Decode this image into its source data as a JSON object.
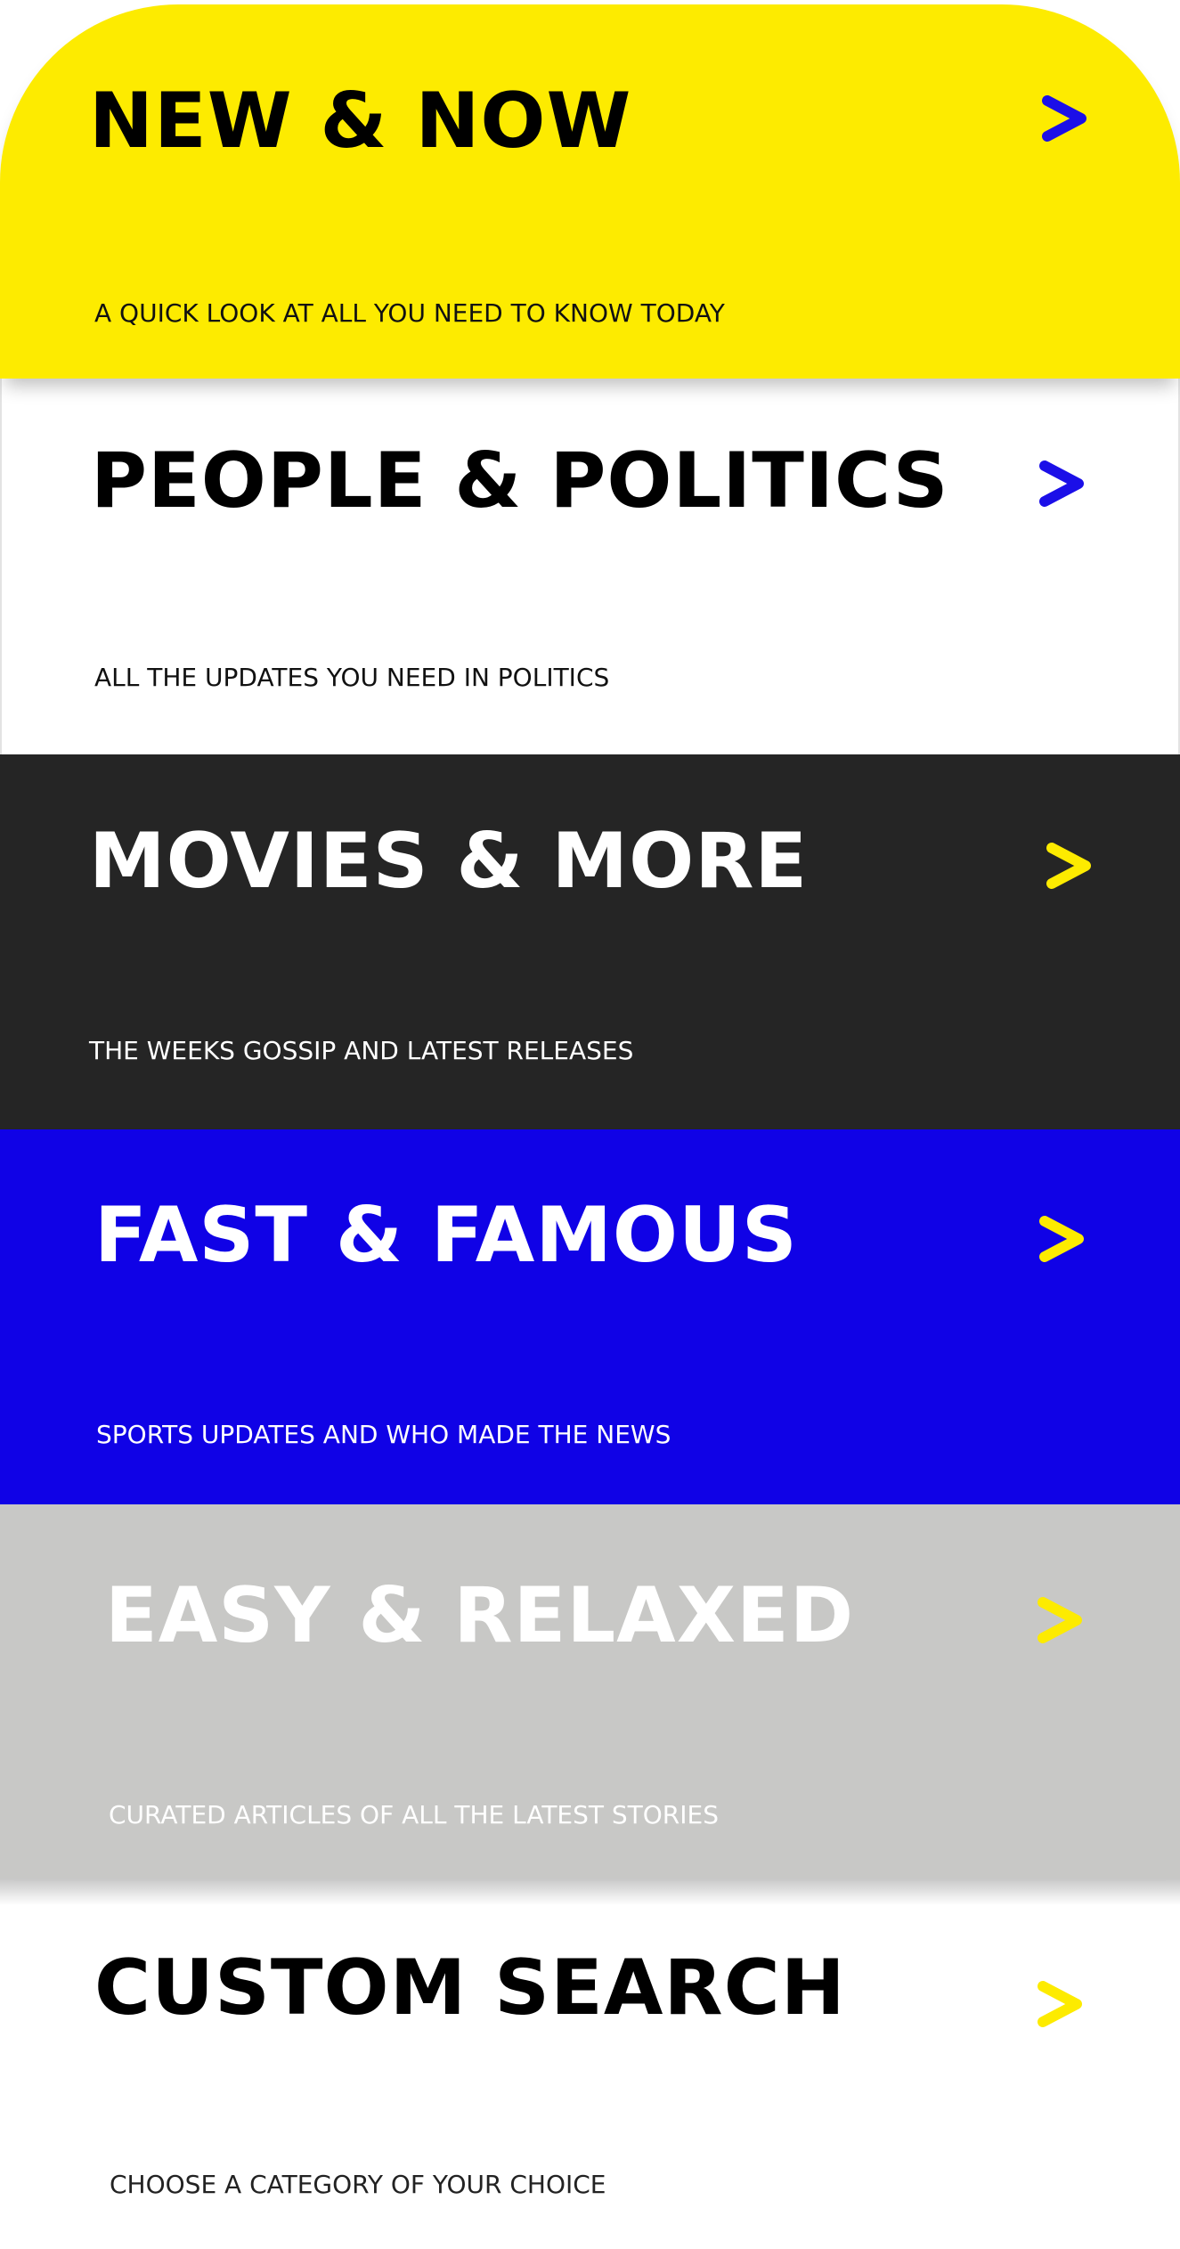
{
  "cards": [
    {
      "title": "NEW & NOW",
      "subtitle": "A QUICK LOOK AT ALL YOU NEED TO KNOW TODAY",
      "bg": "#FDEB00",
      "title_color": "#000000",
      "subtitle_color": "#111111",
      "chevron_color": "#1B0FE8",
      "icon": "chevron-right-icon"
    },
    {
      "title": "PEOPLE & POLITICS",
      "subtitle": "ALL THE UPDATES YOU NEED IN POLITICS",
      "bg": "#FFFFFF",
      "title_color": "#000000",
      "subtitle_color": "#111111",
      "chevron_color": "#1B0FE8",
      "icon": "chevron-right-icon"
    },
    {
      "title": "MOVIES & MORE",
      "subtitle": "THE WEEKS GOSSIP AND LATEST RELEASES",
      "bg": "#252525",
      "title_color": "#FFFFFF",
      "subtitle_color": "#FFFFFF",
      "chevron_color": "#FDEB00",
      "icon": "chevron-right-icon"
    },
    {
      "title": "FAST & FAMOUS",
      "subtitle": "SPORTS UPDATES AND WHO MADE THE NEWS",
      "bg": "#1002E6",
      "title_color": "#FFFFFF",
      "subtitle_color": "#FFFFFF",
      "chevron_color": "#FDEB00",
      "icon": "chevron-right-icon"
    },
    {
      "title": "EASY & RELAXED",
      "subtitle": "CURATED ARTICLES OF ALL THE LATEST STORIES",
      "bg": "#C8C8C6",
      "title_color": "#FFFFFF",
      "subtitle_color": "#FFFFFF",
      "chevron_color": "#FDEB00",
      "icon": "chevron-right-icon"
    },
    {
      "title": "CUSTOM SEARCH",
      "subtitle": "CHOOSE A CATEGORY OF YOUR CHOICE",
      "bg": "#FFFFFF",
      "title_color": "#000000",
      "subtitle_color": "#222222",
      "chevron_color": "#FDEB00",
      "icon": "chevron-right-icon"
    }
  ]
}
